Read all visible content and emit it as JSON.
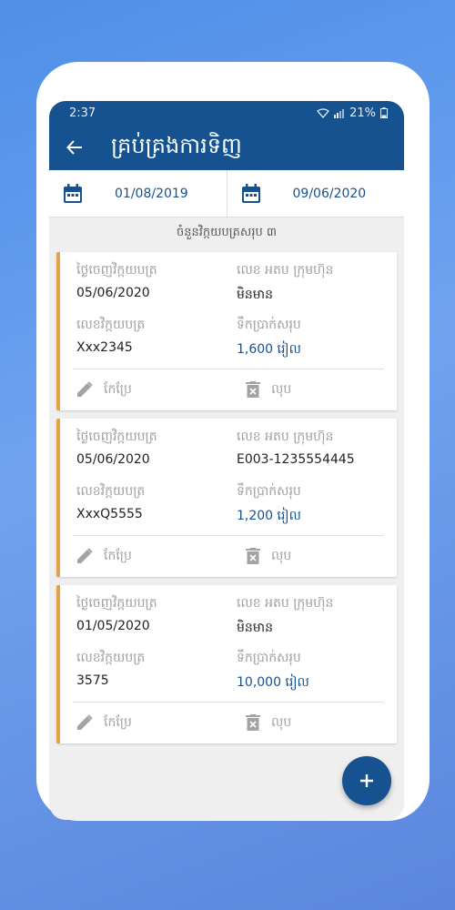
{
  "status_bar": {
    "time": "2:37",
    "battery": "21%"
  },
  "app_bar": {
    "title": "គ្រប់គ្រងការទិញ"
  },
  "date_range": {
    "from": "01/08/2019",
    "to": "09/06/2020"
  },
  "summary": {
    "count_text": "ចំនួនវិក្កយបត្រសរុប ៣"
  },
  "labels": {
    "invoice_date": "ថ្ងៃចេញវិក្កយបត្រ",
    "company_vat": "លេខ អតប ក្រុមហ៊ុន",
    "invoice_no": "លេខវិក្កយបត្រ",
    "total": "ទឹកប្រាក់សរុប",
    "edit": "កែប្រែ",
    "delete": "លុប"
  },
  "invoices": [
    {
      "date": "05/06/2020",
      "vat": "មិនមាន",
      "number": "Xxx2345",
      "amount": "1,600 រៀល"
    },
    {
      "date": "05/06/2020",
      "vat": "E003-1235554445",
      "number": "XxxQ5555",
      "amount": "1,200 រៀល"
    },
    {
      "date": "01/05/2020",
      "vat": "មិនមាន",
      "number": "3575",
      "amount": "10,000 រៀល"
    }
  ],
  "colors": {
    "primary": "#15528f",
    "accent": "#e3a24a"
  }
}
